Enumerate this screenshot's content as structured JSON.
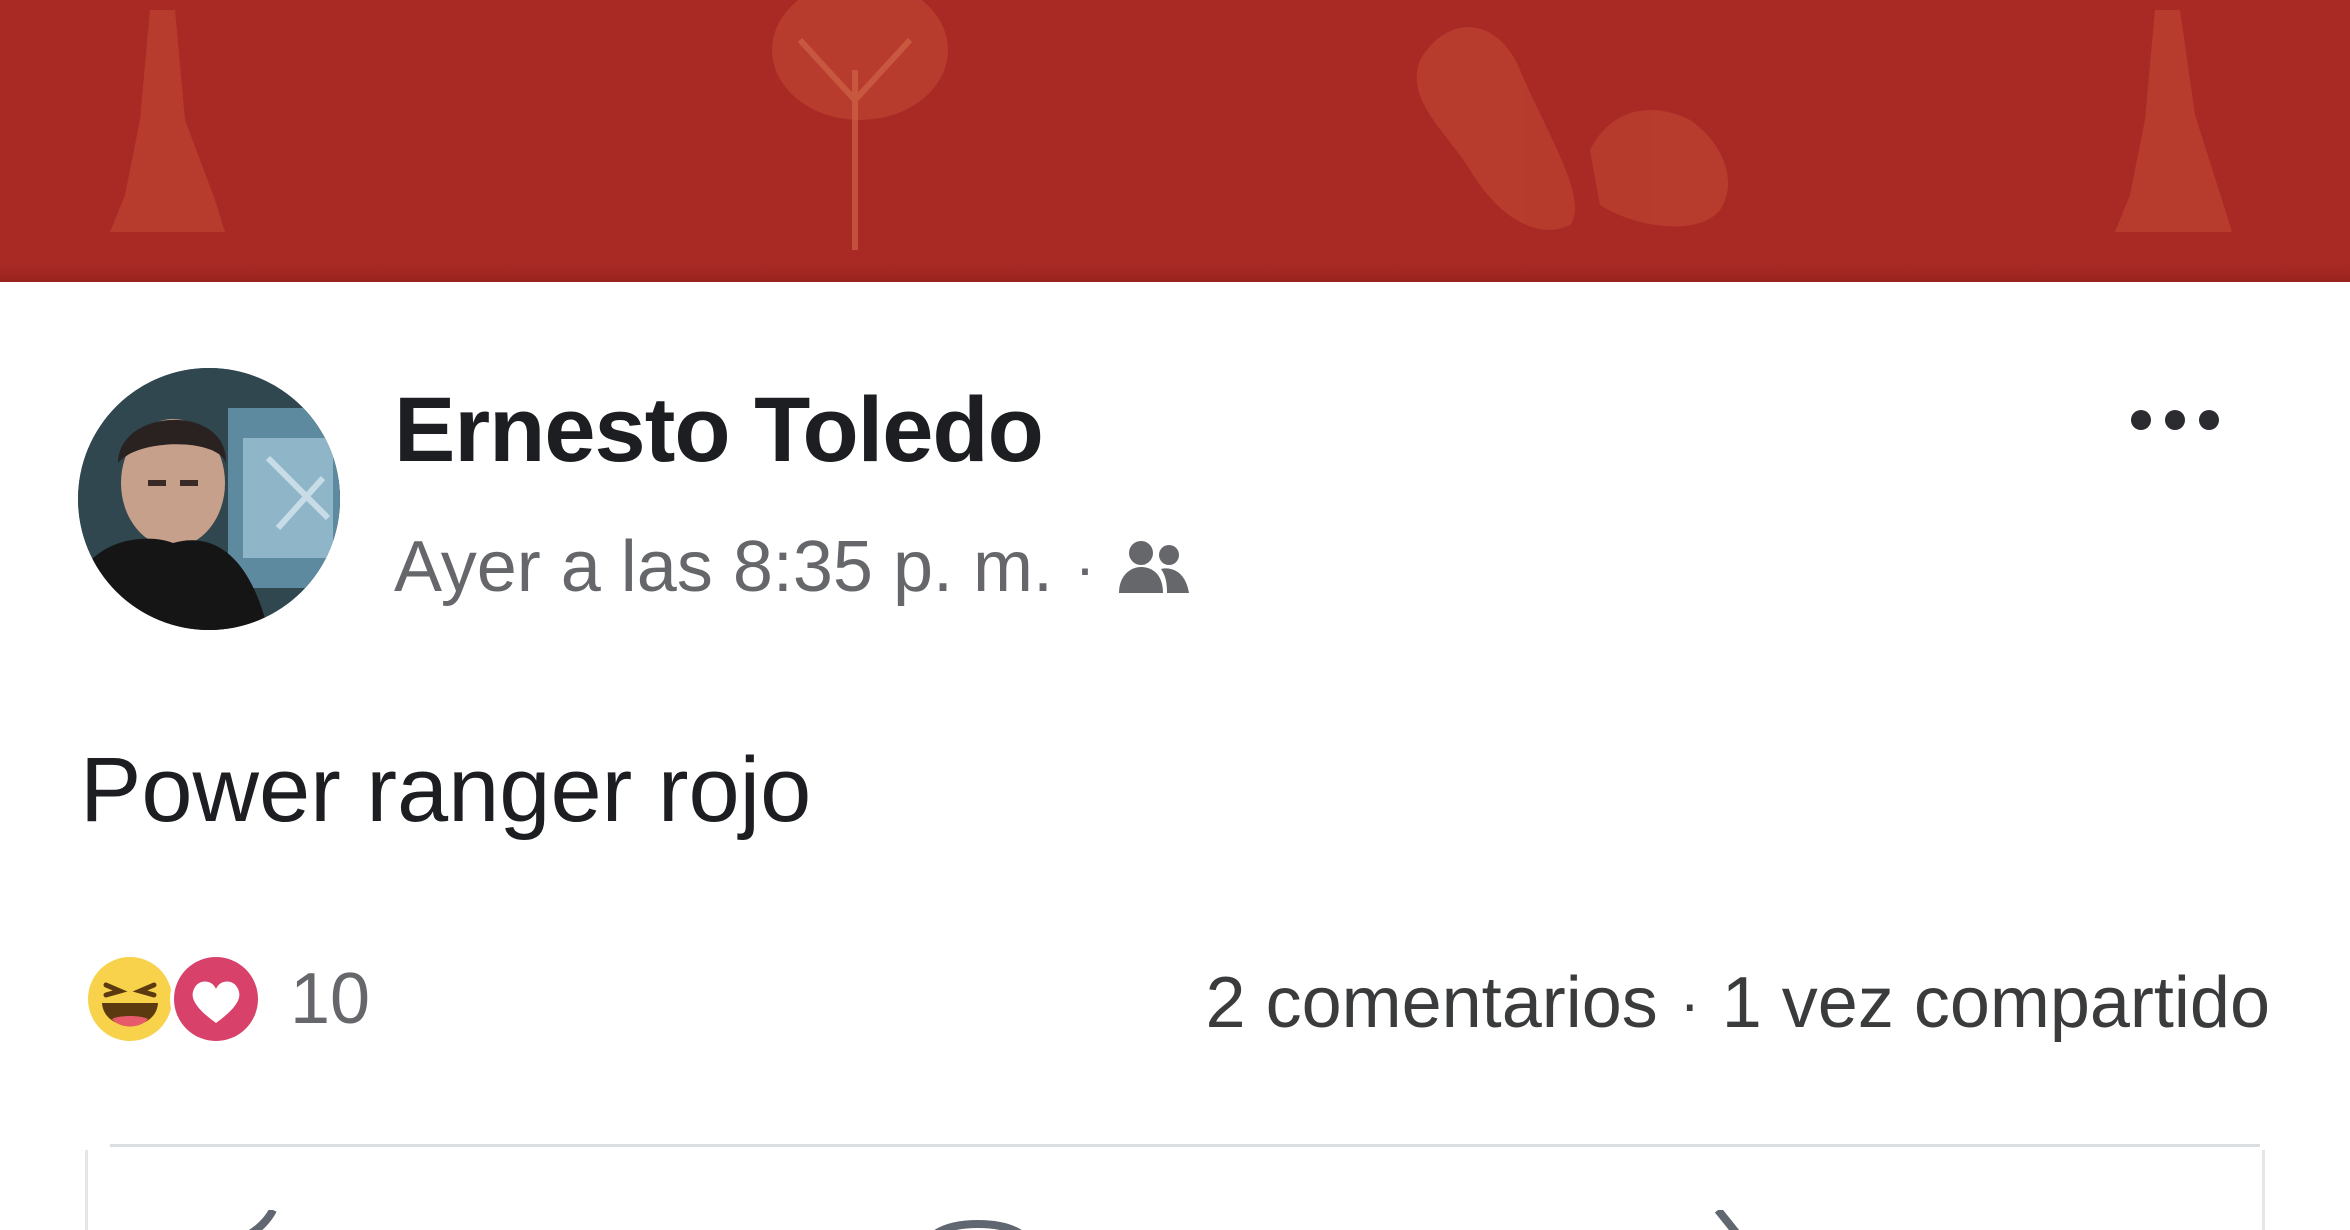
{
  "post": {
    "author": "Ernesto Toledo",
    "timestamp": "Ayer a las 8:35 p. m.",
    "meta_separator": "·",
    "audience_icon": "friends-icon",
    "text": "Power ranger rojo"
  },
  "reactions": {
    "icons": [
      "haha-reaction-icon",
      "love-reaction-icon"
    ],
    "count": "10"
  },
  "counts": {
    "comments": "2 comentarios",
    "separator": "·",
    "shares": "1 vez compartido"
  },
  "colors": {
    "cover": "#a92a25",
    "name": "#1c1e21",
    "secondary_text": "#65676b",
    "divider": "#dadde1"
  }
}
